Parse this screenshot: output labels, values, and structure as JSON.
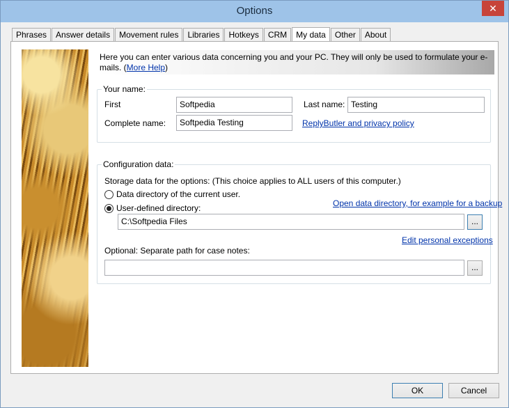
{
  "window": {
    "title": "Options",
    "close_symbol": "✕"
  },
  "tabs": [
    {
      "label": "Phrases"
    },
    {
      "label": "Answer details"
    },
    {
      "label": "Movement rules"
    },
    {
      "label": "Libraries"
    },
    {
      "label": "Hotkeys"
    },
    {
      "label": "CRM"
    },
    {
      "label": "My data"
    },
    {
      "label": "Other"
    },
    {
      "label": "About"
    }
  ],
  "info": {
    "text": "Here you can enter various data concerning you and your PC. They will only be used to formulate your e-mails. (",
    "more_help": "More Help",
    "close_paren": ")"
  },
  "your_name": {
    "group_label": "Your name:",
    "first_label": "First",
    "first_value": "Softpedia",
    "last_label": "Last name:",
    "last_value": "Testing",
    "complete_label": "Complete name:",
    "complete_value": "Softpedia Testing",
    "privacy_link": "ReplyButler and privacy policy"
  },
  "config": {
    "group_label": "Configuration data:",
    "storage_text": "Storage data for the options: (This choice applies to ALL users of this computer.)",
    "option_current_user": "Data directory of the current user.",
    "option_user_defined": "User-defined directory:",
    "selected_option": "User-defined directory:",
    "open_dir_link": "Open data directory, for example for a backup",
    "directory_value": "C:\\Softpedia Files",
    "browse_label": "...",
    "exceptions_link": "Edit personal exceptions",
    "case_notes_label": "Optional: Separate path for case notes:",
    "case_notes_value": "",
    "browse2_label": "..."
  },
  "buttons": {
    "ok": "OK",
    "cancel": "Cancel"
  }
}
